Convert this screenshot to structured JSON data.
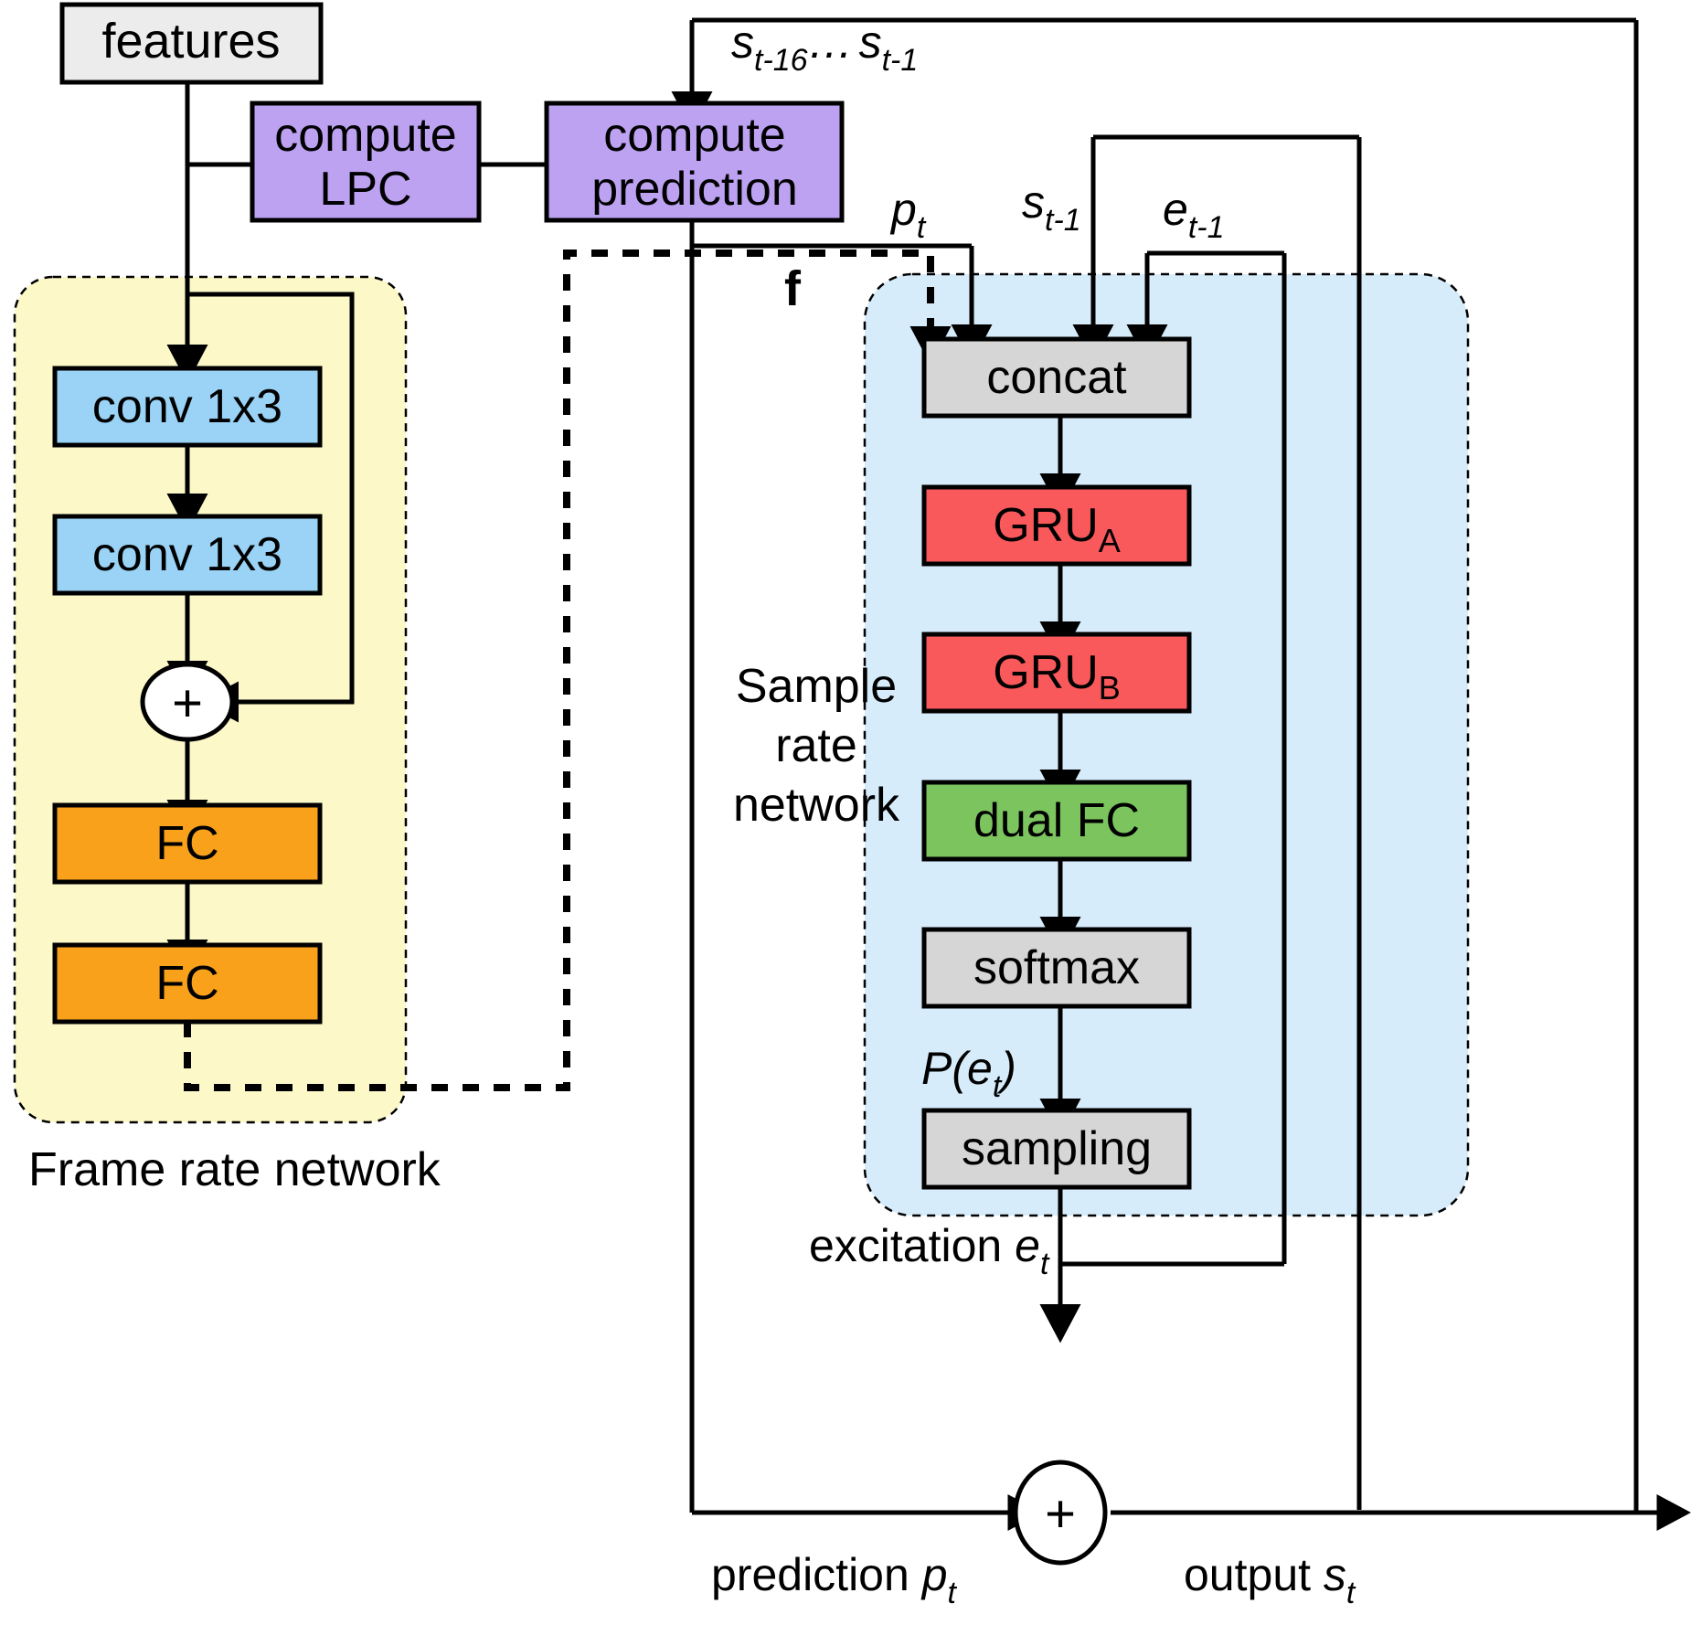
{
  "diagram": {
    "title": "LPCNet architecture block diagram",
    "groups": [
      {
        "id": "frame_rate_network",
        "label": "Frame rate network",
        "fill": "#fcf8c8"
      },
      {
        "id": "sample_rate_network",
        "label": "Sample rate network",
        "label_lines": [
          "Sample",
          "rate",
          "network"
        ],
        "fill": "#d7ecfb"
      }
    ],
    "blocks": {
      "features": {
        "label": "features",
        "fill": "#ececec"
      },
      "compute_lpc": {
        "label_lines": [
          "compute",
          "LPC"
        ],
        "fill": "#bda2f2"
      },
      "compute_prediction": {
        "label_lines": [
          "compute",
          "prediction"
        ],
        "fill": "#bda2f2"
      },
      "conv1": {
        "label": "conv 1x3",
        "fill": "#9ad3f5"
      },
      "conv2": {
        "label": "conv 1x3",
        "fill": "#9ad3f5"
      },
      "add_frame": {
        "label": "+",
        "fill": "#ffffff"
      },
      "fc1": {
        "label": "FC",
        "fill": "#f9a11b"
      },
      "fc2": {
        "label": "FC",
        "fill": "#f9a11b"
      },
      "concat": {
        "label": "concat",
        "fill": "#d6d6d6"
      },
      "gru_a": {
        "label": "GRU",
        "sub": "A",
        "fill": "#f9595b"
      },
      "gru_b": {
        "label": "GRU",
        "sub": "B",
        "fill": "#f9595b"
      },
      "dual_fc": {
        "label": "dual FC",
        "fill": "#7cc45e"
      },
      "softmax": {
        "label": "softmax",
        "fill": "#d6d6d6"
      },
      "sampling": {
        "label": "sampling",
        "fill": "#d6d6d6"
      },
      "add_output": {
        "label": "+",
        "fill": "#ffffff"
      }
    },
    "signals": {
      "s_history": {
        "main": "s",
        "sub1": "t-16",
        "mid": "…",
        "main2": "s",
        "sub2": "t-1"
      },
      "p_t": {
        "main": "p",
        "sub": "t"
      },
      "s_tm1": {
        "main": "s",
        "sub": "t-1"
      },
      "e_tm1": {
        "main": "e",
        "sub": "t-1"
      },
      "f": {
        "main": "f"
      },
      "p_e_t": {
        "prefix": "P(",
        "main": "e",
        "sub": "t",
        "suffix": ")"
      },
      "excitation": {
        "text": "excitation ",
        "main": "e",
        "sub": "t"
      },
      "prediction": {
        "text": "prediction ",
        "main": "p",
        "sub": "t"
      },
      "output": {
        "text": "output ",
        "main": "s",
        "sub": "t"
      }
    },
    "colors": {
      "stroke": "#000000",
      "frame_fill": "#fcf8c8",
      "sample_fill": "#d7ecfb",
      "purple": "#bda2f2",
      "blue": "#9ad3f5",
      "orange": "#f9a11b",
      "red": "#f9595b",
      "green": "#7cc45e",
      "grey": "#d6d6d6",
      "lightgrey": "#ececec"
    }
  }
}
